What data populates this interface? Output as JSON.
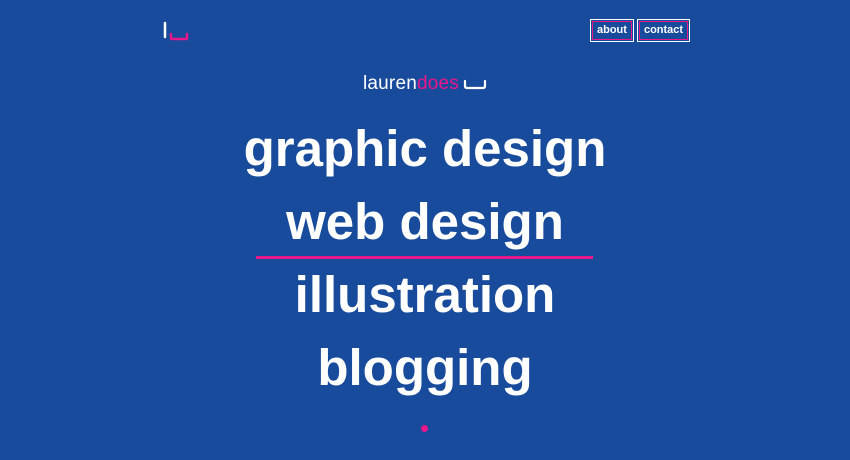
{
  "header": {
    "logo_icon": "lauren-does-logo-mark",
    "nav": [
      {
        "label": "about"
      },
      {
        "label": "contact"
      }
    ]
  },
  "brand": {
    "name": "lauren",
    "suffix": "does"
  },
  "services": [
    {
      "label": "graphic design"
    },
    {
      "label": "web design",
      "highlighted": true
    },
    {
      "label": "illustration"
    },
    {
      "label": "blogging"
    }
  ],
  "colors": {
    "background": "#184b9b",
    "accent": "#e8178a",
    "text": "#ffffff"
  }
}
